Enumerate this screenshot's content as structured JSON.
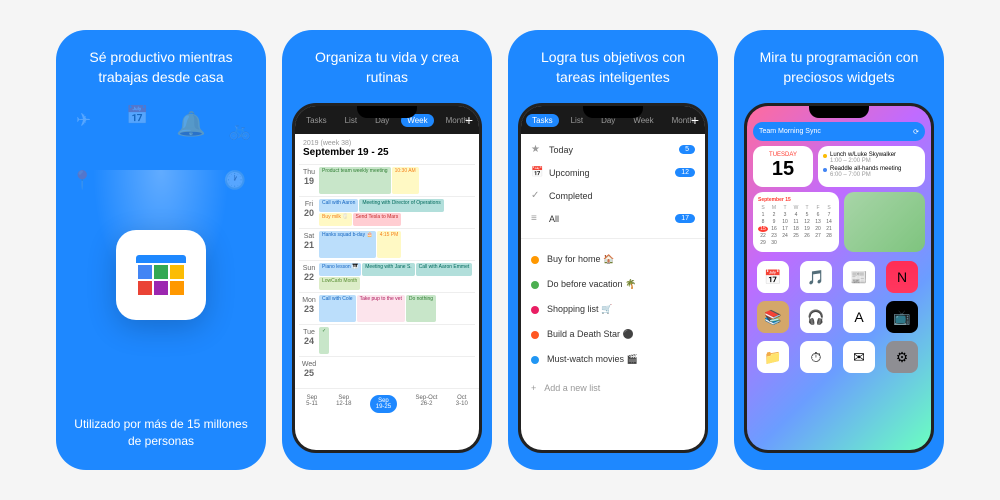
{
  "cards": [
    {
      "title": "Sé productivo mientras trabajas desde casa",
      "subtitle": "Utilizado por más de 15 millones de personas"
    },
    {
      "title": "Organiza tu vida y crea rutinas",
      "tabs": [
        "Tasks",
        "List",
        "Day",
        "Week",
        "Month"
      ],
      "activeTab": "Week",
      "weekLabel": "2019 (week 38)",
      "weekDates": "September 19 - 25",
      "days": [
        {
          "day": "Thu",
          "num": "19",
          "events": [
            {
              "cls": "ev-green",
              "text": "Product team weekly meeting"
            },
            {
              "cls": "ev-yellow",
              "text": "10:30 AM"
            }
          ]
        },
        {
          "day": "Fri",
          "num": "20",
          "events": [
            {
              "cls": "ev-blue",
              "text": "Call with Aaron"
            },
            {
              "cls": "ev-teal",
              "text": "Meeting with Director of Operations"
            },
            {
              "cls": "ev-yellow",
              "text": "Buy milk 🥛"
            },
            {
              "cls": "ev-red",
              "text": "Send Tesla to Mars"
            }
          ]
        },
        {
          "day": "Sat",
          "num": "21",
          "events": [
            {
              "cls": "ev-blue",
              "text": "Hanks squad b-day 🎂"
            },
            {
              "cls": "ev-yellow",
              "text": "4:15 PM"
            }
          ]
        },
        {
          "day": "Sun",
          "num": "22",
          "events": [
            {
              "cls": "ev-blue",
              "text": "Piano lesson 🎹"
            },
            {
              "cls": "ev-teal",
              "text": "Meeting with Jane S."
            },
            {
              "cls": "ev-teal",
              "text": "Call with Aaron Emmet"
            },
            {
              "cls": "ev-lime",
              "text": "LowCarb Month"
            }
          ]
        },
        {
          "day": "Mon",
          "num": "23",
          "events": [
            {
              "cls": "ev-blue",
              "text": "Call with Cole"
            },
            {
              "cls": "ev-pink",
              "text": "Take pup to the vet"
            },
            {
              "cls": "ev-green",
              "text": "Do nothing"
            }
          ]
        },
        {
          "day": "Tue",
          "num": "24",
          "events": [
            {
              "cls": "ev-green",
              "text": "✓"
            }
          ]
        },
        {
          "day": "Wed",
          "num": "25",
          "events": []
        }
      ],
      "bottomDates": [
        {
          "label": "Sep",
          "range": "5-11"
        },
        {
          "label": "Sep",
          "range": "12-18"
        },
        {
          "label": "Sep",
          "range": "19-25",
          "active": true
        },
        {
          "label": "Sep-Oct",
          "range": "26-2"
        },
        {
          "label": "Oct",
          "range": "3-10"
        }
      ]
    },
    {
      "title": "Logra tus objetivos con tareas inteligentes",
      "tabs": [
        "Tasks",
        "List",
        "Day",
        "Week",
        "Month"
      ],
      "activeTab": "Tasks",
      "sections": [
        {
          "icon": "★",
          "label": "Today",
          "badge": "5"
        },
        {
          "icon": "📅",
          "label": "Upcoming",
          "badge": "12"
        },
        {
          "icon": "✓",
          "label": "Completed",
          "badge": ""
        },
        {
          "icon": "≡",
          "label": "All",
          "badge": "17"
        }
      ],
      "lists": [
        {
          "color": "#ff9800",
          "text": "Buy for home 🏠"
        },
        {
          "color": "#4caf50",
          "text": "Do before vacation 🌴"
        },
        {
          "color": "#e91e63",
          "text": "Shopping list 🛒"
        },
        {
          "color": "#ff5722",
          "text": "Build a Death Star ⚫"
        },
        {
          "color": "#2196f3",
          "text": "Must-watch movies 🎬"
        }
      ],
      "addNew": "Add a new list"
    },
    {
      "title": "Mira tu programación con preciosos widgets",
      "widgetHeader": "Team Morning Sync",
      "widgetDay": "Tuesday",
      "widgetNum": "15",
      "events": [
        {
          "color": "#fbbc04",
          "text": "Lunch w/Luke Skywalker",
          "time": "1:00 – 2:00 PM"
        },
        {
          "color": "#4285f4",
          "text": "Readdle all-hands meeting",
          "time": "6:00 – 7:00 PM"
        }
      ],
      "calMonth": "September 15",
      "apps": [
        {
          "bg": "#fff",
          "icon": "📅"
        },
        {
          "bg": "#fff",
          "icon": "🎵"
        },
        {
          "bg": "#fff",
          "icon": "📰"
        },
        {
          "bg": "linear-gradient(#ff2d55,#ff375f)",
          "icon": "N"
        },
        {
          "bg": "#d4a76a",
          "icon": "📚"
        },
        {
          "bg": "#fff",
          "icon": "🎧"
        },
        {
          "bg": "#fff",
          "icon": "A"
        },
        {
          "bg": "#000",
          "icon": "📺"
        },
        {
          "bg": "#fff",
          "icon": "📁"
        },
        {
          "bg": "#fff",
          "icon": "⏱"
        },
        {
          "bg": "#fff",
          "icon": "✉"
        },
        {
          "bg": "#8e8e93",
          "icon": "⚙"
        }
      ]
    }
  ]
}
